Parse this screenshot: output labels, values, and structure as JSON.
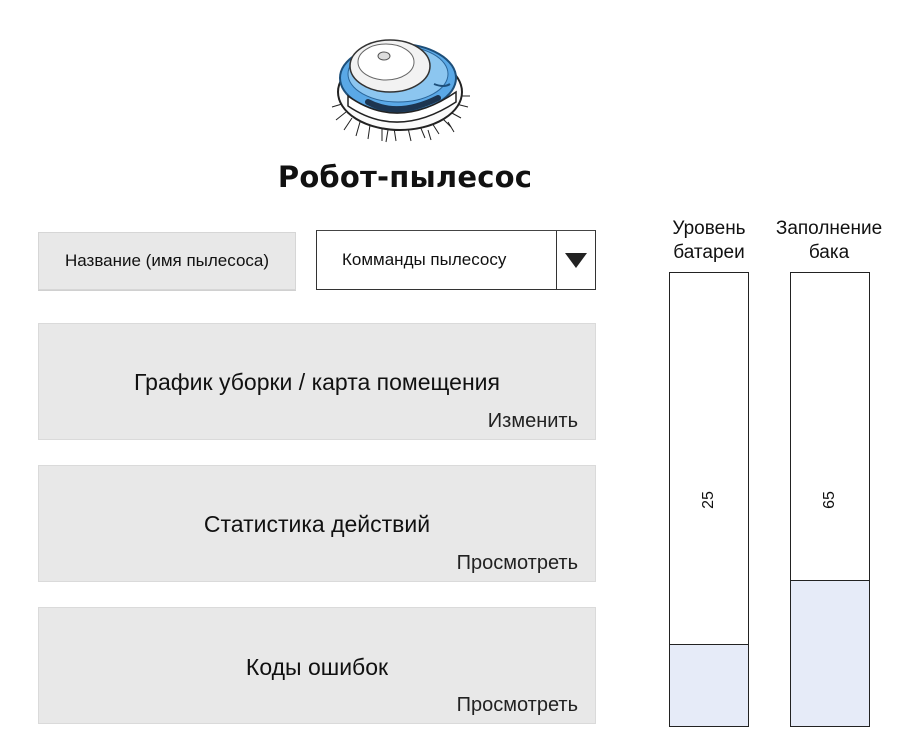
{
  "header": {
    "title": "Робот-пылесос",
    "logo_icon": "robot-vacuum-icon"
  },
  "controls": {
    "device_name": "Название (имя пылесоса)",
    "commands_value": "Комманды пылесосу",
    "dropdown_icon": "triangle-down-icon"
  },
  "cards": [
    {
      "title": "График уборки / карта помещения",
      "action": "Изменить"
    },
    {
      "title": "Статистика действий",
      "action": "Просмотреть"
    },
    {
      "title": "Коды ошибок",
      "action": "Просмотреть"
    }
  ],
  "gauges": {
    "battery": {
      "label_line1": "Уровень",
      "label_line2": "батареи",
      "value": "25",
      "fraction": 0.25
    },
    "bin": {
      "label_line1": "Заполнение",
      "label_line2": "бака",
      "value": "65",
      "fraction": 0.65
    }
  },
  "colors": {
    "card_background": "#e8e8e8",
    "gauge_fill": "#e6ebf8",
    "robot_accent": "#5aa8e6"
  }
}
